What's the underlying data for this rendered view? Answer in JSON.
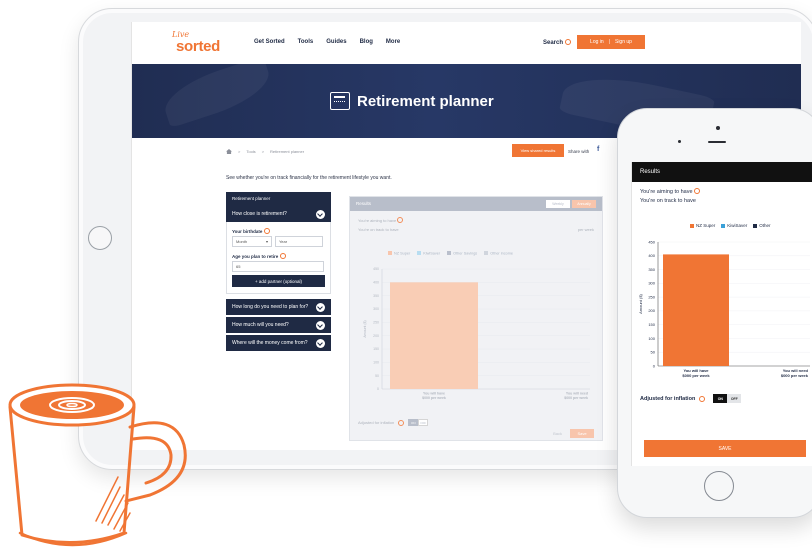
{
  "site": {
    "logo_small": "Live",
    "logo_main": "sorted",
    "nav_items": [
      "Get Sorted",
      "Tools",
      "Guides",
      "Blog",
      "More"
    ],
    "search_label": "Search",
    "login_label": "Log in",
    "signup_label": "Sign up"
  },
  "banner": {
    "title": "Retirement planner"
  },
  "breadcrumb": {
    "items": [
      "Tools",
      "Retirement planner"
    ]
  },
  "share": {
    "button_label": "View shared results",
    "share_label": "Share with"
  },
  "intro_text": "See whether you're on track financially for the retirement lifestyle you want.",
  "sidebar": {
    "header": "Retirement planner",
    "step1": "How close is retirement?",
    "birthdate_label": "Your birthdate",
    "month_placeholder": "Month",
    "year_placeholder": "Year",
    "retire_age_label": "Age you plan to retire",
    "retire_age_value": "65",
    "add_partner_label": "+ add partner (optional)",
    "step2": "How long do you need to plan for?",
    "step3": "How much will you need?",
    "step4": "Where will the money come from?"
  },
  "tablet_results": {
    "header": "Results",
    "tabs": [
      "Weekly",
      "Annually"
    ],
    "line1": "You're aiming to have",
    "line2": "You're on track to have",
    "per_week": "per week",
    "legend": [
      "NZ Super",
      "KiwiSaver",
      "Other Savings",
      "Other income"
    ],
    "y_label": "Amount ($)",
    "adjusted_label": "Adjusted for inflation",
    "toggle": [
      "ON",
      "OFF"
    ],
    "back_label": "Back",
    "save_label": "Save"
  },
  "phone_results": {
    "header": "Results",
    "line1": "You're aiming to have",
    "line2": "You're on track to have",
    "legend": [
      "NZ Super",
      "KiwiSaver",
      "Other"
    ],
    "y_label": "Amount ($)",
    "adjusted_label": "Adjusted for inflation",
    "toggle": [
      "ON",
      "OFF"
    ],
    "save_label": "SAVE"
  },
  "colors": {
    "accent": "#f07534",
    "navy": "#1f2a44",
    "kiwisaver": "#3aa0d8",
    "other": "#1f2a44"
  },
  "chart_data": [
    {
      "type": "bar",
      "categories": [
        "You will have $000 per week",
        "You will need $000 per week"
      ],
      "series": [
        {
          "name": "NZ Super",
          "values": [
            400,
            0
          ]
        }
      ],
      "ylabel": "Amount ($)",
      "yticks": [
        0,
        50,
        100,
        150,
        200,
        250,
        300,
        350,
        400,
        450
      ],
      "ylim": [
        0,
        450
      ],
      "x_tick_labels": [
        [
          "You will have",
          "$000 per week"
        ],
        [
          "You will need",
          "$000 per week"
        ]
      ]
    },
    {
      "type": "bar",
      "categories": [
        "You will have $000 per week",
        "You will need $000 per week"
      ],
      "series": [
        {
          "name": "NZ Super",
          "values": [
            405,
            0
          ]
        }
      ],
      "ylabel": "Amount ($)",
      "yticks": [
        0,
        50,
        100,
        150,
        200,
        250,
        300,
        350,
        400,
        450
      ],
      "ylim": [
        0,
        450
      ],
      "x_tick_labels": [
        [
          "You will have",
          "$000 per week"
        ],
        [
          "You will need",
          "$000 per week"
        ]
      ]
    }
  ]
}
